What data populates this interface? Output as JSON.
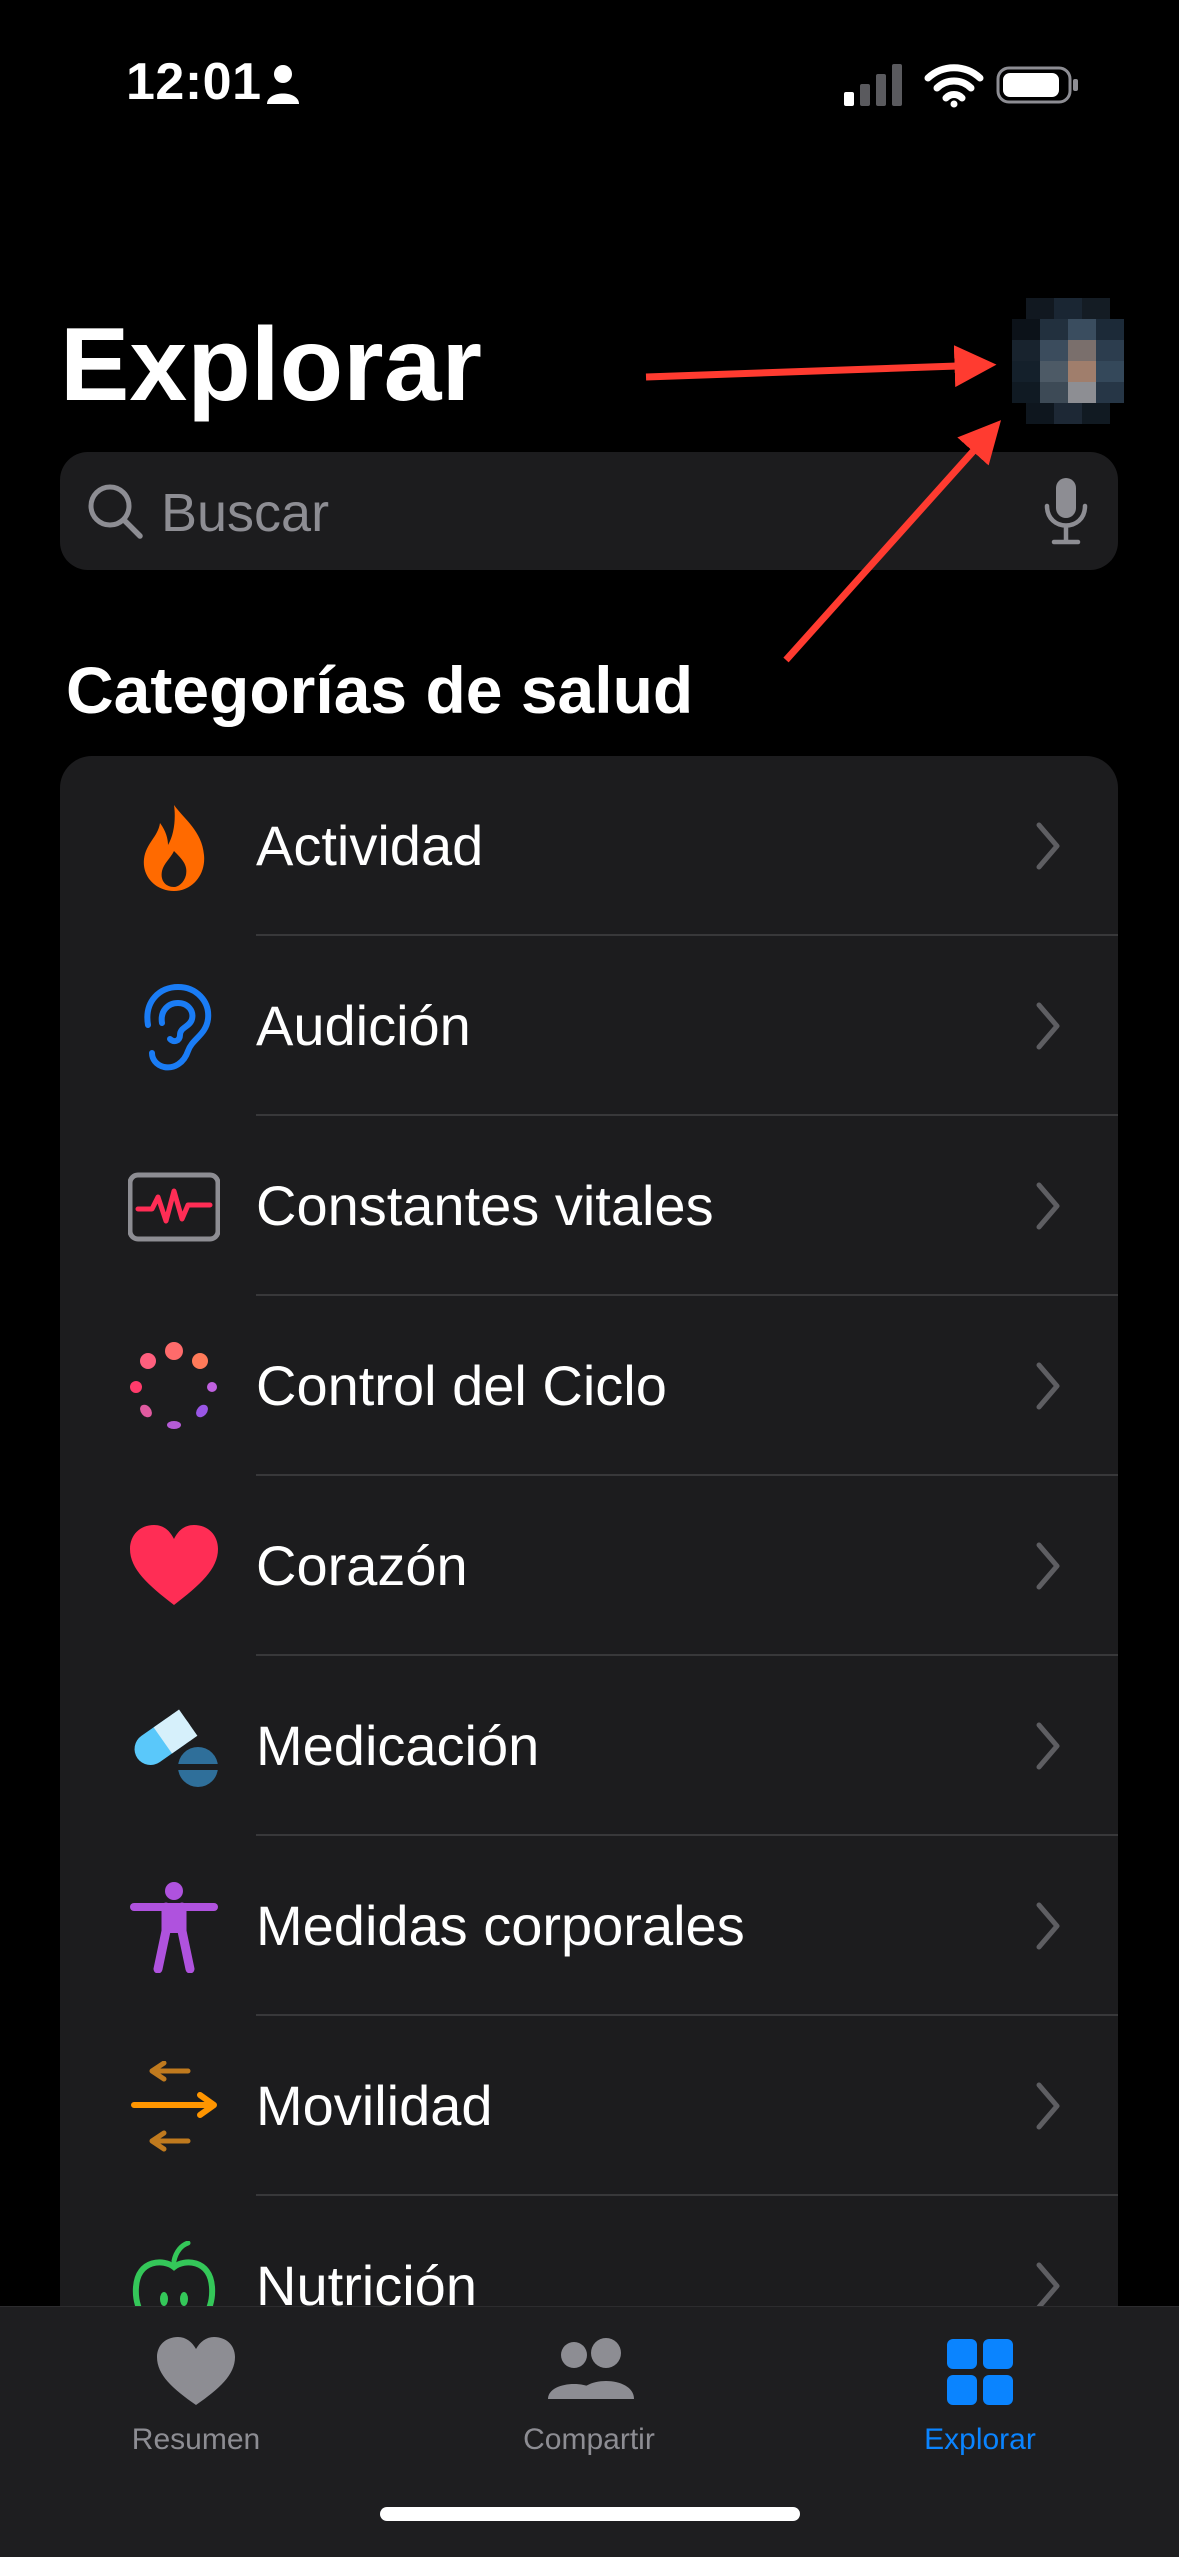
{
  "status_bar": {
    "time": "12:01"
  },
  "header": {
    "title": "Explorar"
  },
  "search": {
    "placeholder": "Buscar"
  },
  "section": {
    "title": "Categorías de salud"
  },
  "categories": [
    {
      "label": "Actividad",
      "icon": "flame-icon",
      "color": "#ff6a00"
    },
    {
      "label": "Audición",
      "icon": "ear-icon",
      "color": "#1a7cf5"
    },
    {
      "label": "Constantes vitales",
      "icon": "vitals-icon",
      "color": "#ff2d55"
    },
    {
      "label": "Control del Ciclo",
      "icon": "cycle-icon",
      "color": "#ff6b6b"
    },
    {
      "label": "Corazón",
      "icon": "heart-icon",
      "color": "#ff2d55"
    },
    {
      "label": "Medicación",
      "icon": "pills-icon",
      "color": "#5ac8fa"
    },
    {
      "label": "Medidas corporales",
      "icon": "body-icon",
      "color": "#af52de"
    },
    {
      "label": "Movilidad",
      "icon": "arrows-icon",
      "color": "#ff9500"
    },
    {
      "label": "Nutrición",
      "icon": "apple-icon",
      "color": "#34c759"
    }
  ],
  "tab_bar": {
    "tabs": [
      {
        "label": "Resumen",
        "icon": "heart-icon",
        "active": false
      },
      {
        "label": "Compartir",
        "icon": "people-icon",
        "active": false
      },
      {
        "label": "Explorar",
        "icon": "grid-icon",
        "active": true
      }
    ]
  },
  "colors": {
    "accent": "#0a84ff",
    "annotation_arrow": "#ff3b30",
    "background": "#000000",
    "card": "#1c1c1e"
  }
}
